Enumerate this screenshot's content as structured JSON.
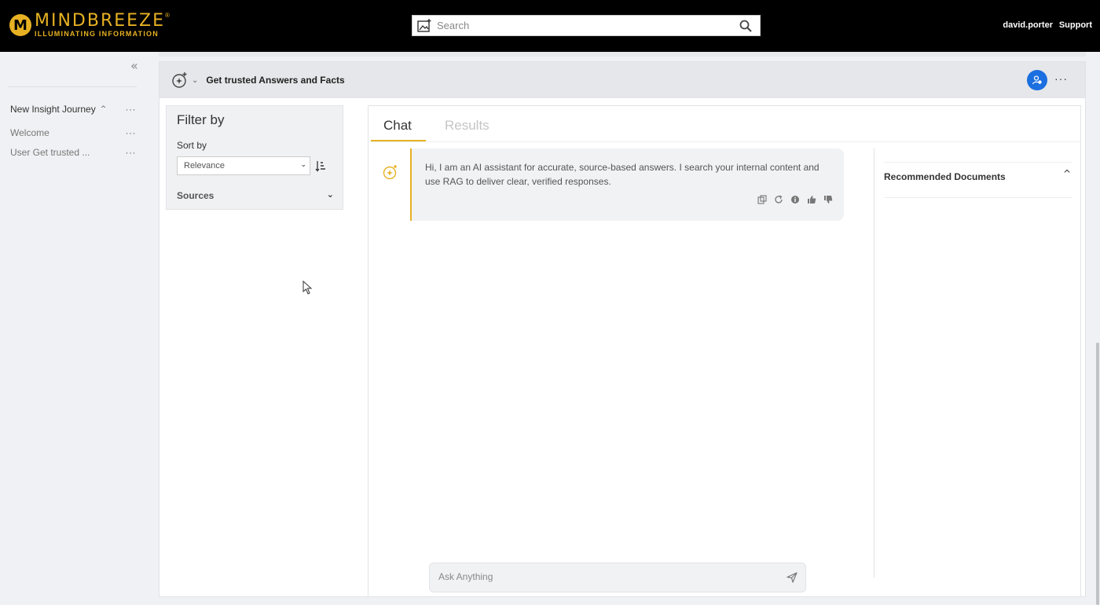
{
  "header": {
    "logo_initial": "M",
    "logo_name": "MINDBREEZE",
    "logo_reg": "®",
    "logo_tagline": "ILLUMINATING INFORMATION",
    "search_placeholder": "Search",
    "user": "david.porter",
    "support": "Support",
    "brand_color": "#e7b123"
  },
  "sidebar": {
    "collapse_glyph": "«",
    "journey": "New Insight Journey",
    "journey_caret": "^",
    "more": "···",
    "items": [
      {
        "label": "Welcome",
        "more": "···"
      },
      {
        "label": "User Get trusted ...",
        "more": "···"
      }
    ]
  },
  "panel": {
    "title": "Get trusted Answers and Facts",
    "chevron": "⌄",
    "more": "···",
    "avatar_color": "#1b6fe0"
  },
  "filter": {
    "title": "Filter by",
    "sort_label": "Sort by",
    "sort_value": "Relevance",
    "sources_label": "Sources"
  },
  "chat": {
    "tabs": [
      {
        "label": "Chat",
        "active": true
      },
      {
        "label": "Results",
        "active": false
      }
    ],
    "message": "Hi, I am an AI assistant for accurate, source-based answers. I search your internal content and use RAG to deliver clear, verified responses.",
    "actions": [
      "copy-icon",
      "refresh-icon",
      "info-icon",
      "thumbs-up-icon",
      "thumbs-down-icon"
    ],
    "input_placeholder": "Ask Anything"
  },
  "recommended": {
    "title": "Recommended Documents"
  }
}
